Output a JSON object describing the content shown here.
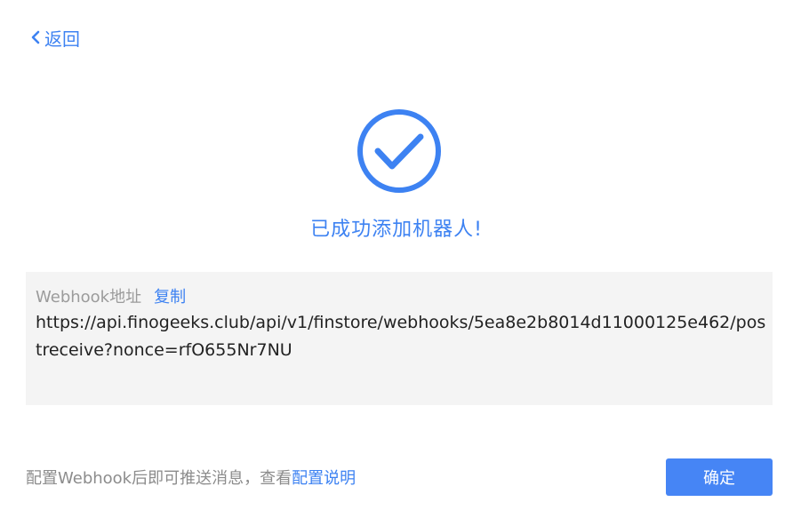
{
  "nav": {
    "back_label": "返回"
  },
  "success": {
    "title": "已成功添加机器人!"
  },
  "webhook": {
    "label": "Webhook地址",
    "copy_label": "复制",
    "url": "https://api.finogeeks.club/api/v1/finstore/webhooks/5ea8e2b8014d11000125e462/postreceive?nonce=rfO655Nr7NU"
  },
  "footer": {
    "note_text": "配置Webhook后即可推送消息，查看",
    "help_link_label": "配置说明",
    "confirm_label": "确定"
  },
  "colors": {
    "accent": "#3d82f2",
    "button": "#4685f5",
    "panel_bg": "#f4f4f4",
    "muted_text": "#8c8c8c"
  },
  "icons": {
    "back": "chevron-left-icon",
    "success": "check-circle-icon"
  }
}
